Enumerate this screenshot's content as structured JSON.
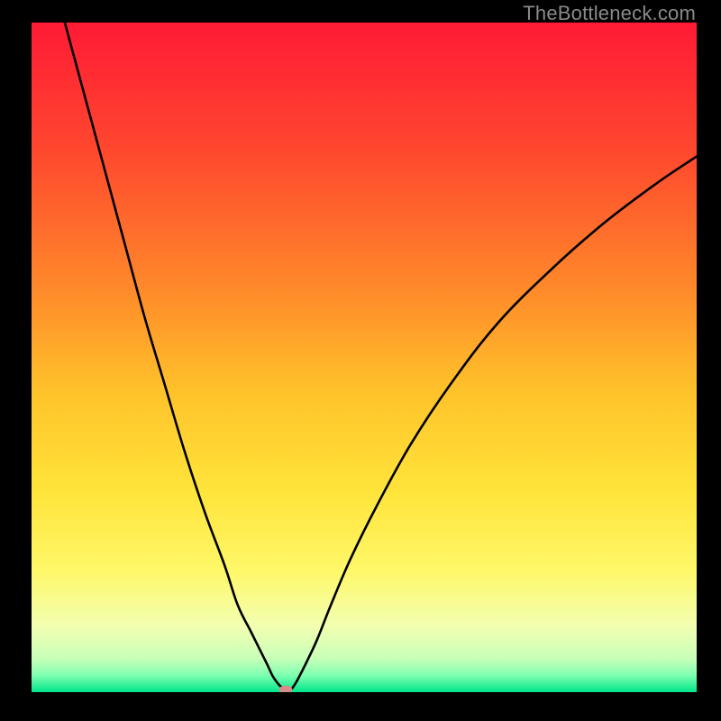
{
  "watermark": {
    "text": "TheBottleneck.com"
  },
  "chart_data": {
    "type": "line",
    "title": "",
    "xlabel": "",
    "ylabel": "",
    "xlim": [
      0,
      100
    ],
    "ylim": [
      0,
      100
    ],
    "grid": false,
    "legend": false,
    "background_gradient": {
      "stops": [
        {
          "offset": 0.0,
          "color": "#ff1a35"
        },
        {
          "offset": 0.2,
          "color": "#ff4a2e"
        },
        {
          "offset": 0.4,
          "color": "#ff8a2a"
        },
        {
          "offset": 0.55,
          "color": "#ffc22a"
        },
        {
          "offset": 0.7,
          "color": "#ffe43a"
        },
        {
          "offset": 0.82,
          "color": "#fff86a"
        },
        {
          "offset": 0.9,
          "color": "#f3ffb0"
        },
        {
          "offset": 0.95,
          "color": "#c8ffb8"
        },
        {
          "offset": 0.975,
          "color": "#7dffb0"
        },
        {
          "offset": 1.0,
          "color": "#00e58a"
        }
      ]
    },
    "series": [
      {
        "name": "bottleneck-curve",
        "color": "#000000",
        "x": [
          5,
          8,
          11,
          14,
          17,
          20,
          23,
          26,
          29,
          31,
          33,
          34.5,
          35.5,
          36.2,
          36.8,
          37.3,
          37.8,
          38.1,
          38.3,
          38.5
        ],
        "y": [
          100,
          89,
          78,
          67,
          56,
          46,
          36,
          27,
          19,
          13,
          9,
          6,
          4,
          2.5,
          1.6,
          1.0,
          0.6,
          0.3,
          0.12,
          0.05
        ]
      },
      {
        "name": "bottleneck-curve-right",
        "color": "#000000",
        "x": [
          38.5,
          38.8,
          39.2,
          39.8,
          40.6,
          41.6,
          43,
          45,
          48,
          52,
          57,
          63,
          70,
          78,
          86,
          94,
          100
        ],
        "y": [
          0.05,
          0.2,
          0.6,
          1.5,
          3,
          5,
          8,
          13,
          20,
          28,
          37,
          46,
          55,
          63,
          70,
          76,
          80
        ]
      }
    ],
    "marker": {
      "name": "optimal-point",
      "x": 38.2,
      "y": 0.4,
      "rx": 1.0,
      "ry": 0.6,
      "color": "#d98b8b"
    }
  }
}
